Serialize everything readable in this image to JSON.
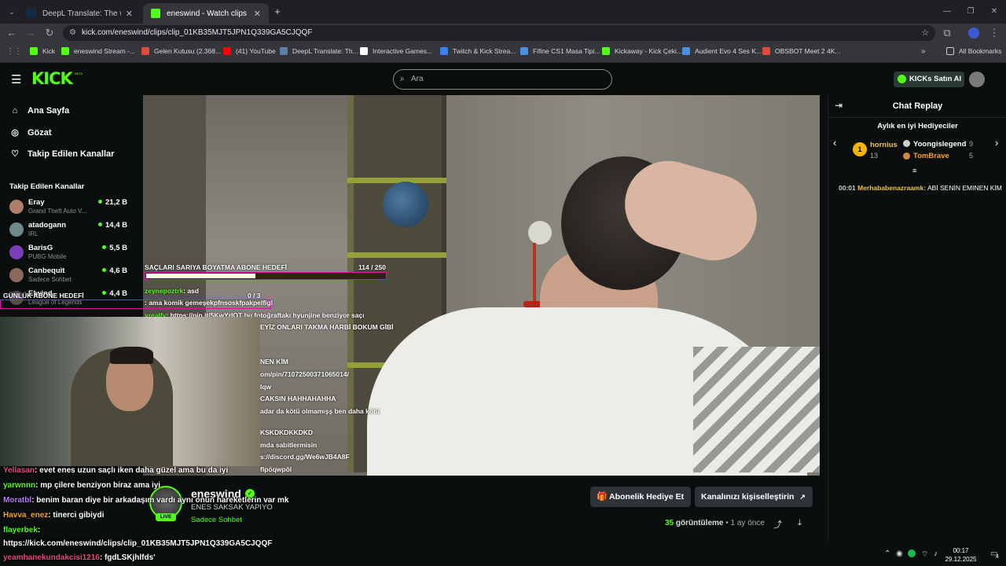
{
  "tabs": [
    {
      "label": "DeepL Translate: The world's m",
      "active": false
    },
    {
      "label": "eneswind - Watch clips on Kick",
      "active": true
    }
  ],
  "address": {
    "url": "kick.com/eneswind/clips/clip_01KB35MJT5JPN1Q339GA5CJQQF"
  },
  "bookmarks": [
    {
      "label": "Kick",
      "color": "#53fc18"
    },
    {
      "label": "eneswind Stream -...",
      "color": "#53fc18"
    },
    {
      "label": "Gelen Kutusu (2.368...",
      "color": "#e24b3b"
    },
    {
      "label": "(41) YouTube",
      "color": "#ff0000"
    },
    {
      "label": "DeepL Translate: Th...",
      "color": "#0f2b46"
    },
    {
      "label": "Interactive Games...",
      "color": "#ffffff"
    },
    {
      "label": "Twitch & Kick Strea...",
      "color": "#3b82f6"
    },
    {
      "label": "Fifine CS1 Masa Tipi...",
      "color": "#4a8fe0"
    },
    {
      "label": "Kickaway - Kick Çeki...",
      "color": "#53fc18"
    },
    {
      "label": "Audient Evo 4 Ses K...",
      "color": "#4a8fe0"
    },
    {
      "label": "OBSBOT Meet 2 4K...",
      "color": "#e24b3b"
    },
    {
      "label": "All Bookmarks",
      "color": "#cccccc"
    }
  ],
  "header": {
    "logo": "KICK",
    "beta": "BETA",
    "search_placeholder": "Ara",
    "kicks_button": "KICKs Satın Al"
  },
  "sidebar": {
    "nav": [
      {
        "label": "Ana Sayfa",
        "icon": "home-icon"
      },
      {
        "label": "Gözat",
        "icon": "compass-icon"
      },
      {
        "label": "Takip Edilen Kanallar",
        "icon": "heart-icon"
      }
    ],
    "followed_title": "Takip Edilen Kanallar",
    "channels": [
      {
        "name": "Eray",
        "category": "Grand Theft Auto V...",
        "viewers": "21,2 B"
      },
      {
        "name": "atadogann",
        "category": "IRL",
        "viewers": "14,4 B"
      },
      {
        "name": "BarisG",
        "category": "PUBG Mobile",
        "viewers": "5,5 B"
      },
      {
        "name": "Canbequit",
        "category": "Sadece Sohbet",
        "viewers": "4,6 B"
      },
      {
        "name": "Elwind",
        "category": "League of Legends",
        "viewers": "4,4 B"
      }
    ]
  },
  "overlay": {
    "goal_title": "SAÇLARI SARIYA BOYATMA ABONE HEDEFİ",
    "goal_progress": "114  / 250",
    "goal_fraction": 0.456,
    "daily_title": "GÜNLÜK ABONE HEDEFİ",
    "daily_progress": "0  / 3",
    "stream_chat": [
      {
        "user": "zeynepoztrk",
        "text": ": asd"
      },
      {
        "user": "",
        "text": ": ama komik gemeşekpfnsoskfpakpelfigl"
      },
      {
        "user": "yrealfy",
        "text": ": https://pin.it/5KwYrIOT bu fotoğraftakı hyunjine benziyor saçı"
      },
      {
        "user": "",
        "text": "EYİZ ONLARI TAKMA HARBİ BOKUM GİBİ"
      },
      {
        "user": "",
        "text": "NEN KİM"
      },
      {
        "user": "",
        "text": "om/pin/71072500371065014/"
      },
      {
        "user": "",
        "text": "lqw"
      },
      {
        "user": "",
        "text": "CAKSIN HAHHAHAHHA"
      },
      {
        "user": "",
        "text": "adar da kötü olmamışş ben daha kötü"
      },
      {
        "user": "",
        "text": "KSKDKDKKDKD"
      },
      {
        "user": "",
        "text": "mda sabitlermisin"
      },
      {
        "user": "",
        "text": "s://discord.gg/We6wJB4A8F"
      },
      {
        "user": "",
        "text": "flpöqwpöl"
      }
    ]
  },
  "bottom_chat": [
    {
      "user": "Yellasan",
      "text": ": evet enes uzun saçlı iken daha güzel ama bu da iyi",
      "color": "#e84a7a"
    },
    {
      "user": "yarwnnn",
      "text": ": mp çilere benziyon biraz ama iyi",
      "color": "#53fc18"
    },
    {
      "user": "Moratbl",
      "text": ": benim baran diye bir arkadaşım vardı aynı onun hareketlerin var mk",
      "color": "#b37df5"
    },
    {
      "user": "Havva_enez",
      "text": ": tinerci gibiydi",
      "color": "#f5a623"
    },
    {
      "user": "flayerbek",
      "text": ":",
      "color": "#53fc18"
    },
    {
      "user": "",
      "text": "https://kick.com/eneswind/clips/clip_01KB35MJT5JPN1Q339GA5CJQQF",
      "color": "#ffffff"
    },
    {
      "user": "yeamhanekundakcisi1216",
      "text": ": fgdLSKjhlfds'",
      "color": "#e84a7a"
    }
  ],
  "channel": {
    "name": "eneswind",
    "live": "LIVE",
    "title": "ENES SAKSAK YAPIYO",
    "category": "Sadece Sohbet",
    "gift_sub_button": "Abonelik Hediye Et",
    "customize_button": "Kanalınızı kişiselleştirin",
    "views": "35",
    "views_label": "görüntüleme",
    "time_ago": "• 1 ay önce"
  },
  "chat": {
    "title": "Chat Replay",
    "gifters_title": "Aylık en iyi Hediyeciler",
    "gifters": [
      {
        "rank": "1",
        "name": "hornius",
        "count": "13"
      },
      {
        "rank": "2",
        "name": "Yoongislegend",
        "count": "9"
      },
      {
        "rank": "3",
        "name": "TomBrave",
        "count": "5"
      }
    ],
    "messages": [
      {
        "time": "00:01",
        "user": "Merhababenazraamk:",
        "text": "ABİ SENİN EMINEN KİM"
      }
    ]
  },
  "taskbar": {
    "time": "00:17",
    "date": "29.12.2025",
    "notif": "4"
  },
  "colors": {
    "brand": "#53fc18",
    "bg": "#0b0e0f",
    "goal_border": "#d017a8"
  }
}
